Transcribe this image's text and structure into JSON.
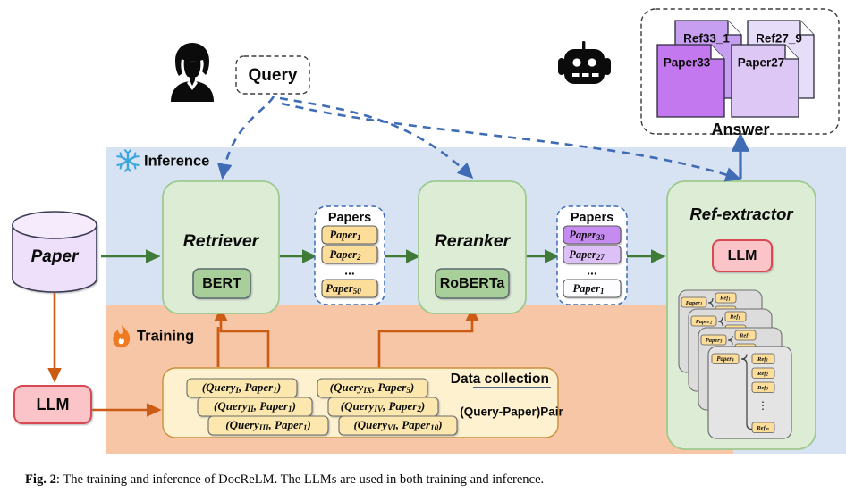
{
  "figure": {
    "caption_label": "Fig. 2",
    "caption_sep": ":",
    "caption_text": " The training and inference of DocReLM. The LLMs are used in both training and inference."
  },
  "panels": {
    "inference": {
      "label": "Inference",
      "icon": "snowflake-icon",
      "color": "#d7e2f2"
    },
    "training": {
      "label": "Training",
      "icon": "flame-icon",
      "color": "#f7c6a6"
    }
  },
  "actors": {
    "user": {
      "icon": "user-avatar-icon"
    },
    "robot": {
      "icon": "robot-icon"
    }
  },
  "query_box": {
    "label": "Query"
  },
  "answer_box": {
    "label": "Answer",
    "cards": [
      {
        "label": "Ref33_1",
        "color": "#c79ff0"
      },
      {
        "label": "Ref27_9",
        "color": "#e6ddf8"
      },
      {
        "label": "Paper33",
        "color": "#c478f0"
      },
      {
        "label": "Paper27",
        "color": "#ddc8f5"
      }
    ]
  },
  "paper_db": {
    "label": "Paper",
    "color": "#eee0fb"
  },
  "llm_train": {
    "label": "LLM",
    "color": "#fac4c8"
  },
  "modules": {
    "retriever": {
      "title": "Retriever",
      "model": "BERT"
    },
    "reranker": {
      "title": "Reranker",
      "model": "RoBERTa"
    },
    "ref_extractor": {
      "title": "Ref-extractor",
      "model": "LLM"
    }
  },
  "papers_retrieved": {
    "title": "Papers",
    "items": [
      {
        "label": "Paper",
        "sub": "1",
        "color": "#fcdd9a"
      },
      {
        "label": "Paper",
        "sub": "2",
        "color": "#fcdd9a"
      },
      {
        "label": "...",
        "sub": "",
        "color": "none"
      },
      {
        "label": "Paper",
        "sub": "50",
        "color": "#fcdd9a"
      }
    ]
  },
  "papers_reranked": {
    "title": "Papers",
    "items": [
      {
        "label": "Paper",
        "sub": "33",
        "color": "#c58bf0"
      },
      {
        "label": "Paper",
        "sub": "27",
        "color": "#ddc0f7"
      },
      {
        "label": "...",
        "sub": "",
        "color": "none"
      },
      {
        "label": "Paper",
        "sub": "1",
        "color": "#fdfdff"
      }
    ]
  },
  "ref_cards": [
    {
      "paper": "Paper",
      "paper_sub": "1"
    },
    {
      "paper": "Paper",
      "paper_sub": "2"
    },
    {
      "paper": "Paper",
      "paper_sub": "3"
    },
    {
      "paper": "Paper",
      "paper_sub": "4"
    }
  ],
  "ref_card_front": {
    "paper": "Paper",
    "paper_sub": "4",
    "refs": [
      {
        "label": "Ref",
        "sub": "1"
      },
      {
        "label": "Ref",
        "sub": "2"
      },
      {
        "label": "Ref",
        "sub": "3"
      },
      {
        "label": "Ref",
        "sub": "m"
      }
    ],
    "ellipsis": "⋮"
  },
  "data_collection": {
    "title": "Data collection",
    "subtitle": "(Query-Paper)Pair",
    "pairs_left": [
      {
        "q": "Query",
        "q_sub": "I",
        "p": "Paper",
        "p_sub": "1"
      },
      {
        "q": "Query",
        "q_sub": "II",
        "p": "Paper",
        "p_sub": "1"
      },
      {
        "q": "Query",
        "q_sub": "III",
        "p": "Paper",
        "p_sub": "1"
      }
    ],
    "pairs_right": [
      {
        "q": "Query",
        "q_sub": "IX",
        "p": "Paper",
        "p_sub": "5"
      },
      {
        "q": "Query",
        "q_sub": "IV",
        "p": "Paper",
        "p_sub": "2"
      },
      {
        "q": "Query",
        "q_sub": "VI",
        "p": "Paper",
        "p_sub": "10"
      }
    ]
  },
  "colors": {
    "module_fill": "#ddedd5",
    "module_stroke": "#9fc98e",
    "model_fill": "#a8ce9a",
    "model_stroke": "#5a6b6f",
    "green_arrow": "#3f7a36",
    "orange_arrow": "#cc5b14",
    "blue_arrow": "#3f6cb5",
    "yellow_fill": "#fcdd9a",
    "yellow_panel": "#fdf1d0",
    "card_gray": "#dcdcdc"
  }
}
